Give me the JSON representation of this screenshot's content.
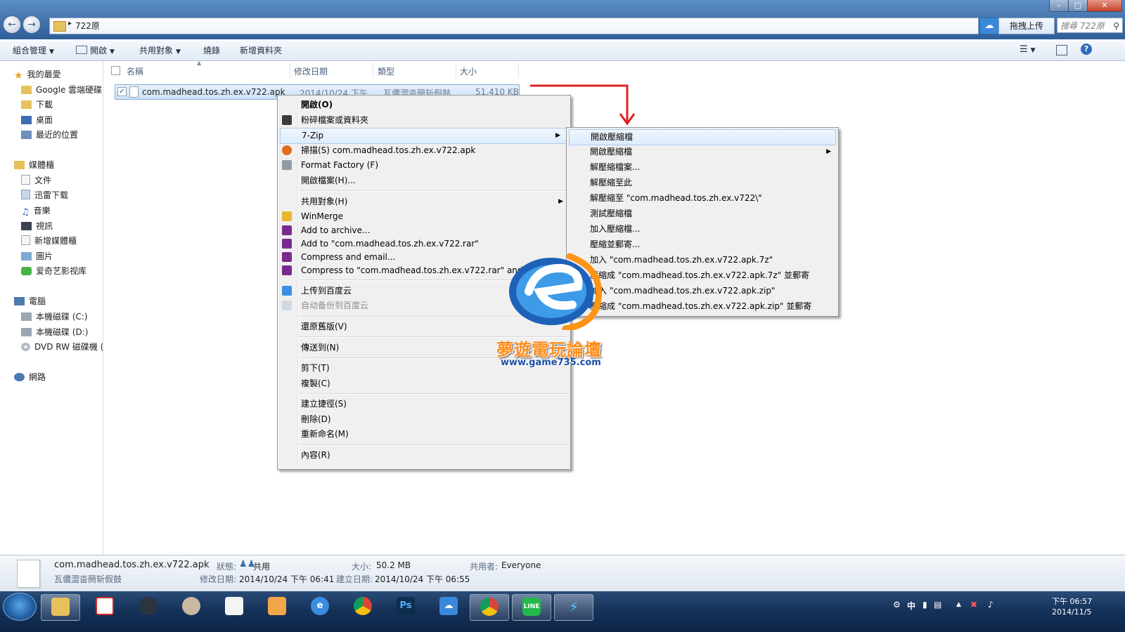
{
  "window": {
    "folder_name": "722原",
    "search_placeholder": "搜尋 722原",
    "upload_label": "拖拽上传"
  },
  "toolbar": {
    "organize": "組合管理",
    "open": "開啟",
    "share": "共用對象",
    "burn": "燒錄",
    "new_folder": "新增資料夾"
  },
  "nav": {
    "favorites": "我的最愛",
    "google_drive": "Google 雲端硬碟",
    "downloads": "下載",
    "desktop": "桌面",
    "recent": "最近的位置",
    "libraries": "媒體櫃",
    "documents": "文件",
    "thunder": "迅雷下载",
    "music": "音樂",
    "videos": "視訊",
    "new_library": "新增媒體櫃",
    "pictures": "圖片",
    "iqiyi": "爱奇艺影视库",
    "computer": "電腦",
    "disk_c": "本機磁碟 (C:)",
    "disk_d": "本機磁碟 (D:)",
    "dvd": "DVD RW 磁碟機 (",
    "network": "網路"
  },
  "columns": {
    "name": "名稱",
    "modified": "修改日期",
    "type": "類型",
    "size": "大小"
  },
  "file": {
    "name": "com.madhead.tos.zh.ex.v722.apk",
    "modified": "2014/10/24 下午 ...",
    "type": "瓦儂澀畓蔄斩假鼓",
    "size": "51,410 KB"
  },
  "context_menu": {
    "items": [
      "開啟(O)",
      "粉碎檔案或資料夾",
      "7-Zip",
      "掃描(S) com.madhead.tos.zh.ex.v722.apk",
      "Format Factory (F)",
      "開啟檔案(H)...",
      "共用對象(H)",
      "WinMerge",
      "Add to archive...",
      "Add to \"com.madhead.tos.zh.ex.v722.rar\"",
      "Compress and email...",
      "Compress to \"com.madhead.tos.zh.ex.v722.rar\" and email",
      "上传到百度云",
      "自动备份到百度云",
      "還原舊版(V)",
      "傳送到(N)",
      "剪下(T)",
      "複製(C)",
      "建立捷徑(S)",
      "刪除(D)",
      "重新命名(M)",
      "內容(R)"
    ]
  },
  "submenu": {
    "items": [
      "開啟壓縮檔",
      "開啟壓縮檔",
      "解壓縮檔案...",
      "解壓縮至此",
      "解壓縮至 \"com.madhead.tos.zh.ex.v722\\\"",
      "測試壓縮檔",
      "加入壓縮檔...",
      "壓縮並郵寄...",
      "加入 \"com.madhead.tos.zh.ex.v722.apk.7z\"",
      "壓縮成 \"com.madhead.tos.zh.ex.v722.apk.7z\" 並郵寄",
      "加入 \"com.madhead.tos.zh.ex.v722.apk.zip\"",
      "壓縮成 \"com.madhead.tos.zh.ex.v722.apk.zip\" 並郵寄"
    ]
  },
  "watermark": {
    "name": "夢遊電玩論壇",
    "url": "www.game735.com"
  },
  "details": {
    "filename": "com.madhead.tos.zh.ex.v722.apk",
    "filetype": "瓦儂澀畓蔄斩假鼓",
    "state_label": "狀態:",
    "state_value": "共用",
    "modified_label": "修改日期:",
    "modified_value": "2014/10/24 下午 06:41",
    "size_label": "大小:",
    "size_value": "50.2 MB",
    "created_label": "建立日期:",
    "created_value": "2014/10/24 下午 06:55",
    "shared_label": "共用者:",
    "shared_value": "Everyone"
  },
  "tray": {
    "ime": "中",
    "time": "下午 06:57",
    "date": "2014/11/5"
  },
  "colors": {
    "accent": "#3f6fa8",
    "highlight": "#dcebfc",
    "arrow": "#e02020",
    "watermark_orange": "#ff8c1a",
    "watermark_blue": "#1c4fa3"
  },
  "icons": [
    "back-icon",
    "forward-icon",
    "folder-icon",
    "cloud-icon",
    "search-icon",
    "star-icon",
    "shredder-icon",
    "scan-icon",
    "format-factory-icon",
    "winmerge-icon",
    "winrar-icon",
    "baidu-cloud-icon",
    "start-orb-icon"
  ]
}
